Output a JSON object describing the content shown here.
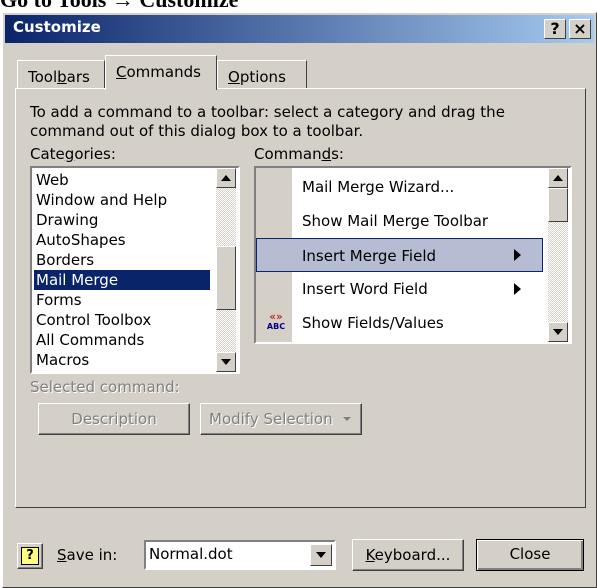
{
  "caption": "Go to Tools → Customize",
  "window": {
    "title": "Customize",
    "help_label": "?",
    "close_label": "×"
  },
  "tabs": [
    {
      "pre": "Tool",
      "key": "b",
      "post": "ars"
    },
    {
      "pre": "",
      "key": "C",
      "post": "ommands"
    },
    {
      "pre": "",
      "key": "O",
      "post": "ptions"
    }
  ],
  "instructions": {
    "line1": "To add a command to a toolbar: select a category and drag the",
    "line2": "command out of this dialog box to a toolbar."
  },
  "categories_label": {
    "pre": "Cate",
    "key": "g",
    "post": "ories:"
  },
  "categories": [
    "Web",
    "Window and Help",
    "Drawing",
    "AutoShapes",
    "Borders",
    "Mail Merge",
    "Forms",
    "Control Toolbox",
    "All Commands",
    "Macros"
  ],
  "selected_category": "Mail Merge",
  "commands_label": {
    "pre": "Comman",
    "key": "d",
    "post": "s:"
  },
  "commands": [
    {
      "label": "Mail Merge Wizard...",
      "submenu": false,
      "icon": ""
    },
    {
      "label": "Show Mail Merge Toolbar",
      "submenu": false,
      "icon": ""
    },
    {
      "label": "Insert Merge Field",
      "submenu": true,
      "icon": ""
    },
    {
      "label": "Insert Word Field",
      "submenu": true,
      "icon": ""
    },
    {
      "label": "Show Fields/Values",
      "submenu": false,
      "icon": "merge-field-icon"
    }
  ],
  "icon_glyphs": {
    "top": "«»",
    "bottom": "ABC"
  },
  "selected_command_label": "Selected command:",
  "description_button": "Description",
  "modify_selection_button": "Modify Selection",
  "save_in_label": {
    "pre": "",
    "key": "S",
    "post": "ave in:"
  },
  "save_in_value": "Normal.dot",
  "keyboard_button": {
    "pre": "",
    "key": "K",
    "post": "eyboard..."
  },
  "close_button": "Close",
  "colors": {
    "titlebar_start": "#0a246a",
    "titlebar_end": "#a6caf0",
    "face": "#d4d0c8",
    "selection": "#0a246a",
    "hover": "#b6bdd2"
  }
}
